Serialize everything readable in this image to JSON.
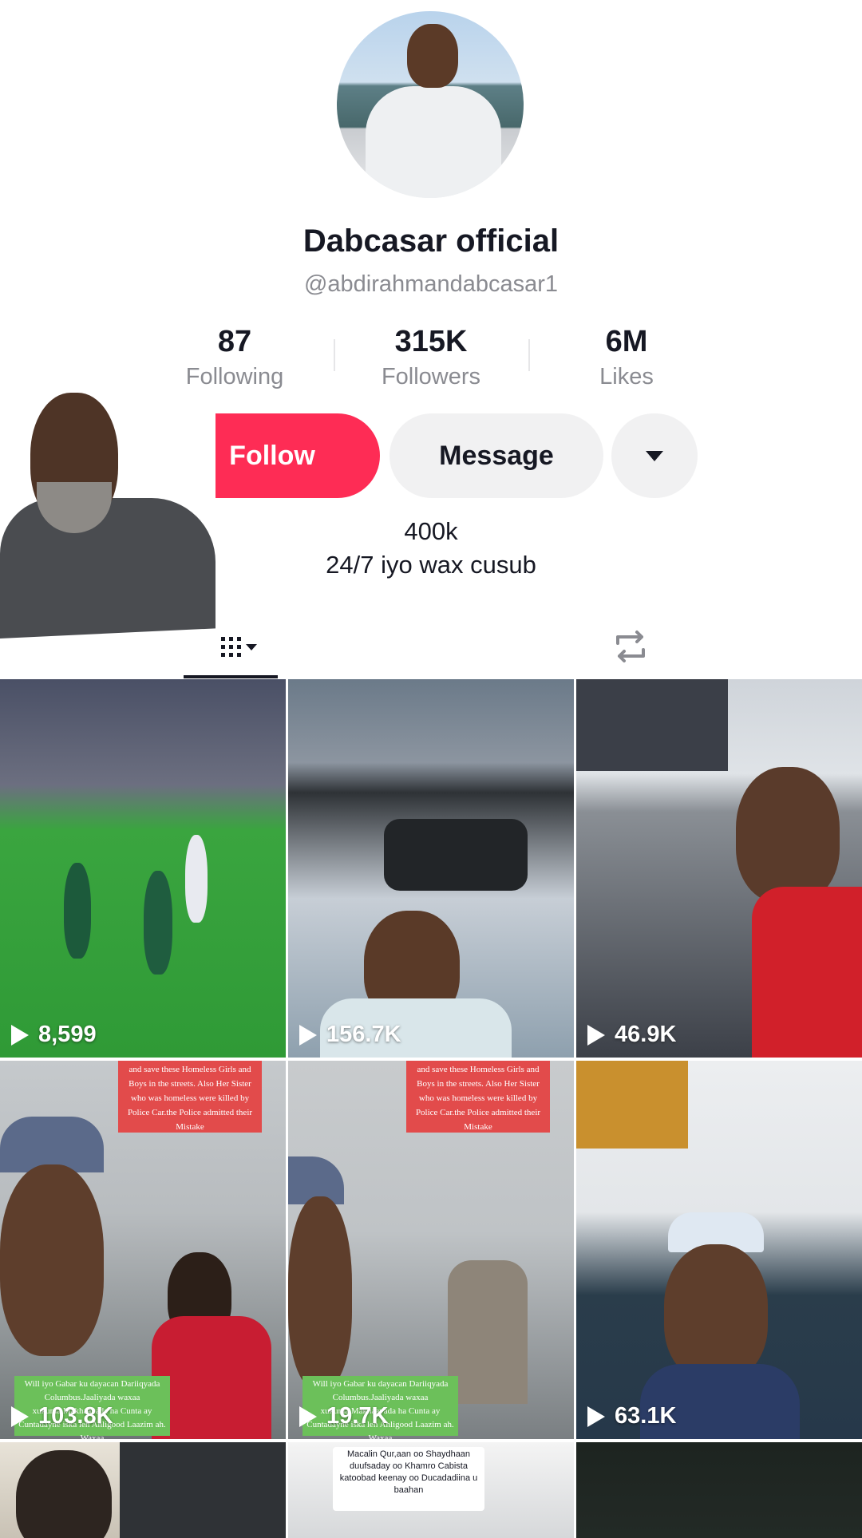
{
  "profile": {
    "display_name": "Dabcasar official",
    "username": "@abdirahmandabcasar1",
    "avatar_icon": "profile-photo"
  },
  "stats": [
    {
      "value": "87",
      "label": "Following"
    },
    {
      "value": "315K",
      "label": "Followers"
    },
    {
      "value": "6M",
      "label": "Likes"
    }
  ],
  "actions": {
    "follow_label": "Follow",
    "message_label": "Message",
    "more_icon": "caret-down-icon"
  },
  "bio": {
    "line1": "400k",
    "line2": "24/7 iyo wax cusub"
  },
  "tabs": {
    "videos_icon": "grid-icon",
    "reposts_icon": "repost-icon"
  },
  "videos": [
    {
      "views": "8,599",
      "overlay": ""
    },
    {
      "views": "156.7K",
      "overlay": ""
    },
    {
      "views": "46.9K",
      "overlay": ""
    },
    {
      "views": "103.8K",
      "overlay_top": "and save these Homeless Girls and Boys in the streets. Also Her Sister who was homeless were killed by Police Car.the Police admitted their Mistake",
      "overlay_bottom": "Will iyo Gabar ku dayacan Dariiqyada Columbus.Jaaliyada waxaa xukuma.Makhaayada ha Cunta ay Cuntadayne iska leh Ahligood Laazim ah. Waxaa"
    },
    {
      "views": "19.7K",
      "overlay_top": "and save these Homeless Girls and Boys in the streets. Also Her Sister who was homeless were killed by Police Car.the Police admitted their Mistake",
      "overlay_bottom": "Will iyo Gabar ku dayacan Dariiqyada Columbus.Jaaliyada waxaa xukuma.Makhaayada ha Cunta ay Cuntadayne iska leh Ahligood Laazim ah. Waxaa"
    },
    {
      "views": "63.1K",
      "overlay": ""
    },
    {
      "views": "",
      "overlay": ""
    },
    {
      "views": "",
      "overlay_top": "Macalin Qur,aan oo Shaydhaan duufsaday oo Khamro Cabista katoobad keenay oo Ducadadiina u baahan"
    },
    {
      "views": "",
      "overlay": ""
    }
  ],
  "colors": {
    "accent": "#fe2c55",
    "secondary_button": "#f1f1f2",
    "muted_text": "#8a8b91"
  }
}
